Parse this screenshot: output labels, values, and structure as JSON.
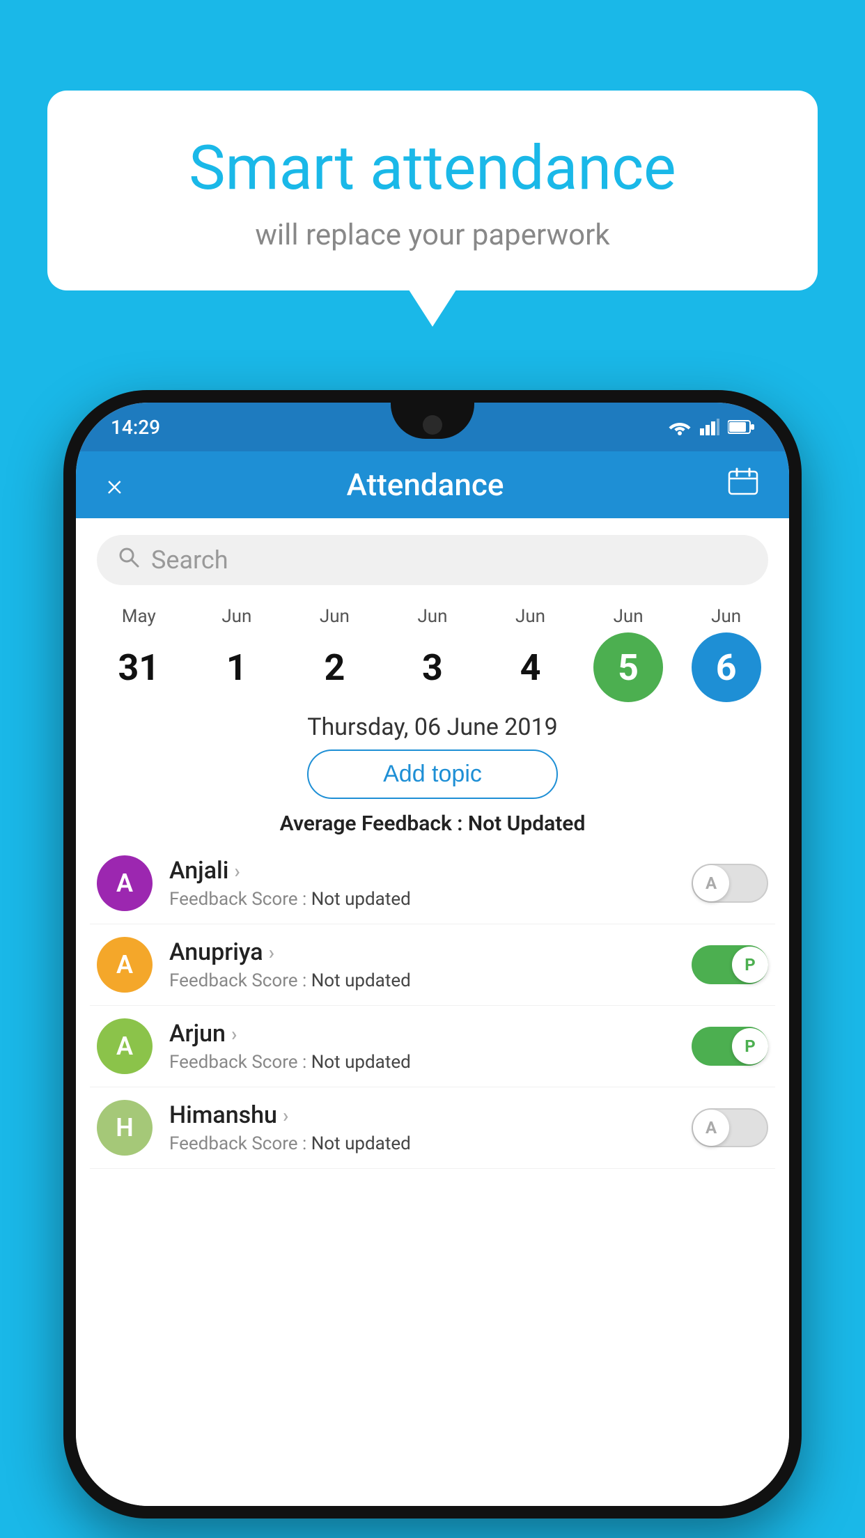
{
  "background_color": "#1ab8e8",
  "speech_bubble": {
    "title": "Smart attendance",
    "subtitle": "will replace your paperwork"
  },
  "phone": {
    "status_bar": {
      "time": "14:29"
    },
    "header": {
      "title": "Attendance",
      "close_label": "×",
      "calendar_icon": "calendar-icon"
    },
    "search": {
      "placeholder": "Search"
    },
    "calendar": {
      "days": [
        {
          "month": "May",
          "day": "31",
          "state": "normal"
        },
        {
          "month": "Jun",
          "day": "1",
          "state": "normal"
        },
        {
          "month": "Jun",
          "day": "2",
          "state": "normal"
        },
        {
          "month": "Jun",
          "day": "3",
          "state": "normal"
        },
        {
          "month": "Jun",
          "day": "4",
          "state": "normal"
        },
        {
          "month": "Jun",
          "day": "5",
          "state": "today"
        },
        {
          "month": "Jun",
          "day": "6",
          "state": "selected"
        }
      ]
    },
    "selected_date": "Thursday, 06 June 2019",
    "add_topic_label": "Add topic",
    "avg_feedback_label": "Average Feedback :",
    "avg_feedback_value": "Not Updated",
    "students": [
      {
        "name": "Anjali",
        "avatar_letter": "A",
        "avatar_color": "#9c27b0",
        "feedback_label": "Feedback Score :",
        "feedback_value": "Not updated",
        "toggle_state": "off",
        "toggle_label": "A"
      },
      {
        "name": "Anupriya",
        "avatar_letter": "A",
        "avatar_color": "#f4a72a",
        "feedback_label": "Feedback Score :",
        "feedback_value": "Not updated",
        "toggle_state": "on",
        "toggle_label": "P"
      },
      {
        "name": "Arjun",
        "avatar_letter": "A",
        "avatar_color": "#8bc34a",
        "feedback_label": "Feedback Score :",
        "feedback_value": "Not updated",
        "toggle_state": "on",
        "toggle_label": "P"
      },
      {
        "name": "Himanshu",
        "avatar_letter": "H",
        "avatar_color": "#a5c878",
        "feedback_label": "Feedback Score :",
        "feedback_value": "Not updated",
        "toggle_state": "off",
        "toggle_label": "A"
      }
    ]
  }
}
